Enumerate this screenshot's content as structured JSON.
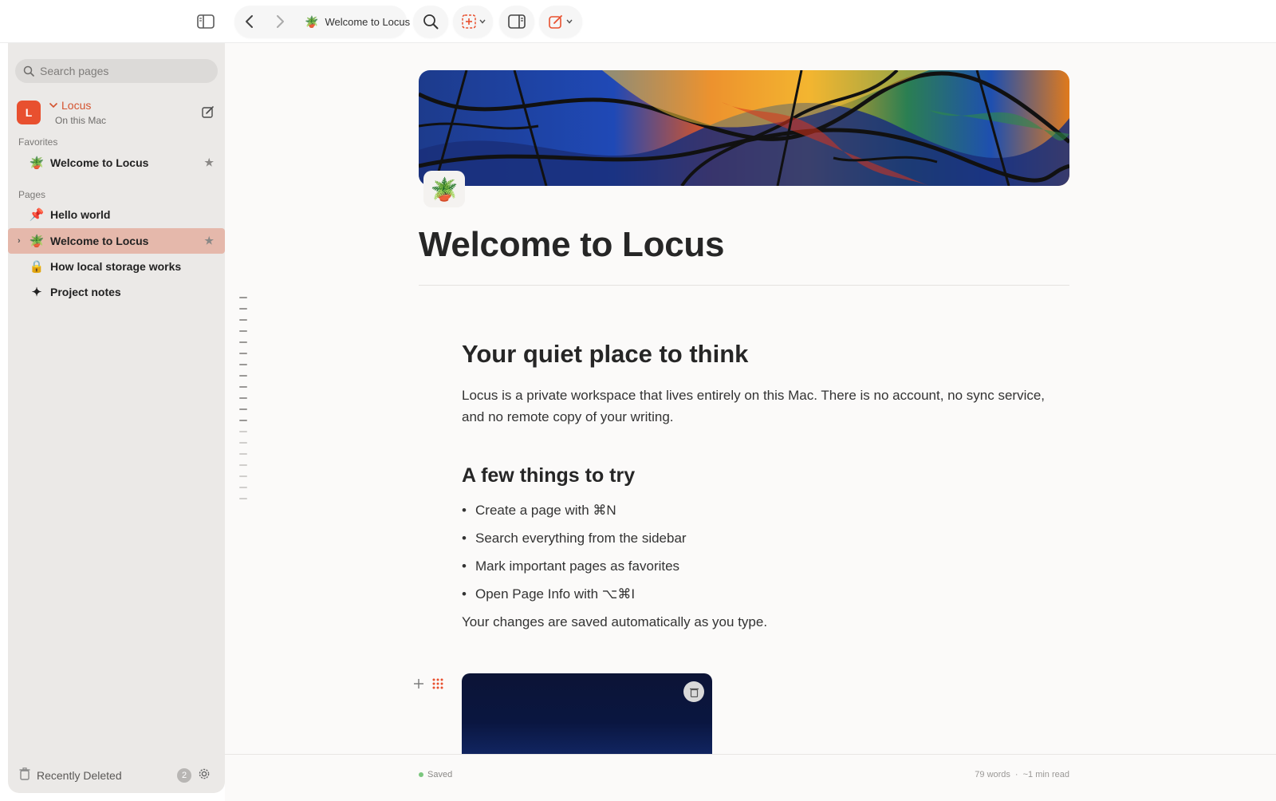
{
  "toolbar": {
    "page_title": "Welcome to Locus",
    "page_emoji": "🪴"
  },
  "sidebar": {
    "search_placeholder": "Search pages",
    "workspace": {
      "initial": "L",
      "name": "Locus",
      "subtitle": "On this Mac"
    },
    "favorites_label": "Favorites",
    "favorites": [
      {
        "icon": "🪴",
        "label": "Welcome to Locus",
        "starred": true
      }
    ],
    "pages_label": "Pages",
    "pages": [
      {
        "icon": "📌",
        "label": "Hello world"
      },
      {
        "icon": "🪴",
        "label": "Welcome to Locus",
        "starred": true,
        "active": true
      },
      {
        "icon": "🔒",
        "label": "How local storage works"
      },
      {
        "icon": "✦",
        "label": "Project notes"
      }
    ],
    "footer": {
      "label": "Recently Deleted",
      "count": "2"
    }
  },
  "page": {
    "icon": "🪴",
    "title": "Welcome to Locus",
    "heading1": "Your quiet place to think",
    "intro": "Locus is a private workspace that lives entirely on this Mac. There is no account, no sync service, and no remote copy of your writing.",
    "heading2": "A few things to try",
    "bullets": [
      "Create a page with ⌘N",
      "Search everything from the sidebar",
      "Mark important pages as favorites",
      "Open Page Info with ⌥⌘I"
    ],
    "outro": "Your changes are saved automatically as you type."
  },
  "status": {
    "saved": "Saved",
    "words": "79 words",
    "separator": "·",
    "read_time": "~1 min read"
  },
  "colors": {
    "accent": "#e8502f",
    "active_row": "#e5b8ab",
    "sidebar_bg": "#ebe9e7"
  }
}
